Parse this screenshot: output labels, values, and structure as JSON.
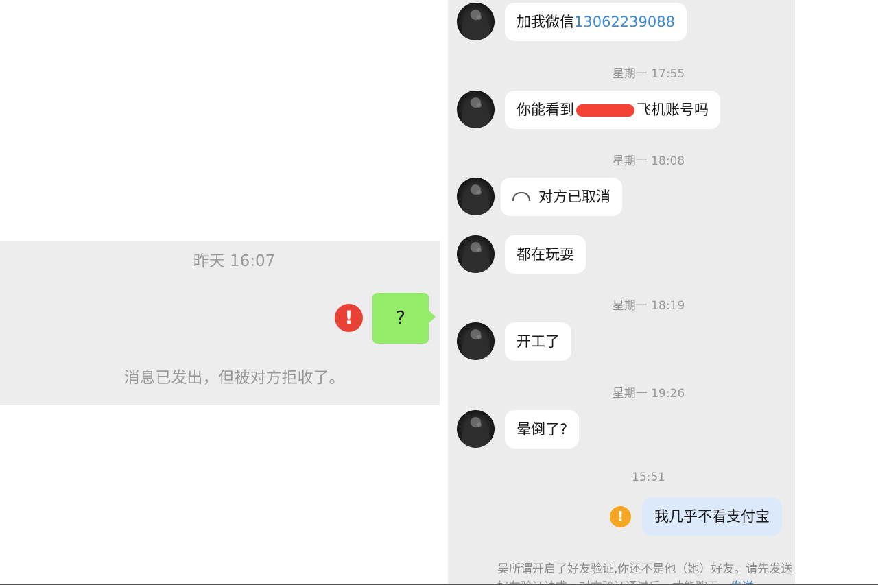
{
  "left": {
    "timestamp": "昨天 16:07",
    "error_icon": "!",
    "message": "?",
    "status": "消息已发出，但被对方拒收了。"
  },
  "right": {
    "messages": [
      {
        "prefix": "加我微信",
        "number": "13062239088"
      },
      {
        "timestamp": "星期一 17:55"
      },
      {
        "before": "你能看到",
        "after": "飞机账号吗"
      },
      {
        "timestamp": "星期一 18:08"
      },
      {
        "text": "对方已取消",
        "icon": "phone-hangup-icon"
      },
      {
        "text": "都在玩耍"
      },
      {
        "timestamp": "星期一 18:19"
      },
      {
        "text": "开工了"
      },
      {
        "timestamp": "星期一 19:26"
      },
      {
        "text": "晕倒了?"
      },
      {
        "timestamp": "15:51"
      }
    ],
    "outgoing": {
      "text": "我几乎不看支付宝",
      "warn_icon": "!"
    },
    "notice": {
      "text": "吴所谓开启了好友验证,你还不是他（她）好友。请先发送好友验证请求，对方验证通过后，才能聊天。",
      "link": "发送"
    }
  },
  "colors": {
    "wechat_green": "#95ec69",
    "error_red": "#e84135",
    "warn_orange": "#f5a623",
    "link_blue": "#3d8bd8"
  }
}
